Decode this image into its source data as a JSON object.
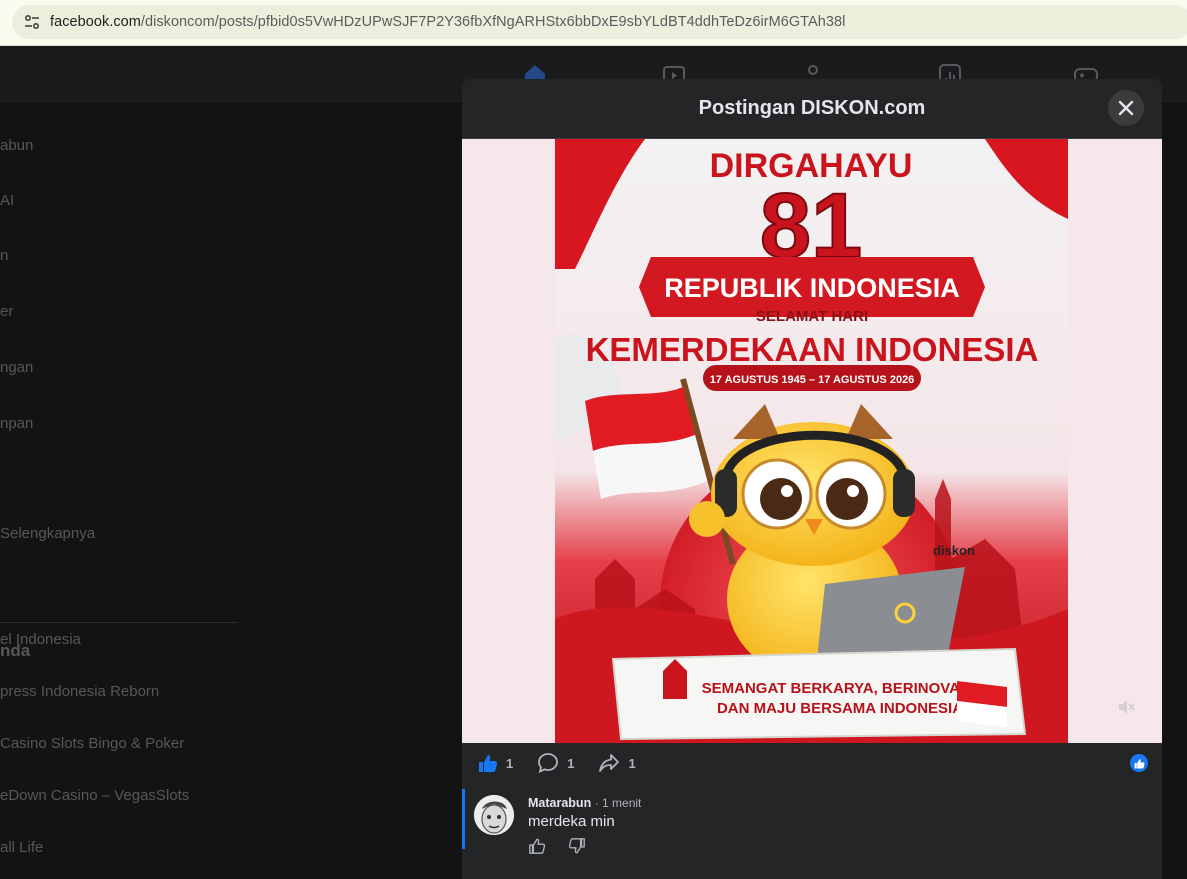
{
  "browser": {
    "url_host": "facebook.com",
    "url_path": "/diskoncom/posts/pfbid0s5VwHDzUPwSJF7P2Y36fbXfNgARHStx6bbDxE9sbYLdBT4ddhTeDz6irM6GTAh38l"
  },
  "sidebar": {
    "items": [
      "abun",
      "AI",
      "n",
      "er",
      "ngan",
      "npan",
      "Selengkapnya"
    ],
    "heading": "nda",
    "games": [
      "el Indonesia",
      "press Indonesia Reborn",
      "Casino Slots Bingo & Poker",
      "eDown Casino – VegasSlots",
      "all Life"
    ]
  },
  "modal": {
    "title": "Postingan DISKON.com",
    "poster": {
      "line1": "DIRGAHAYU",
      "number": "81",
      "banner": "REPUBLIK INDONESIA",
      "sub": "SELAMAT HARI",
      "main": "KEMERDEKAAN INDONESIA",
      "dates": "17 AGUSTUS 1945 – 17 AGUSTUS 2026",
      "brand": "diskon",
      "footer1": "SEMANGAT BERKARYA, BERINOVASI,",
      "footer2": "DAN MAJU BERSAMA INDONESIA"
    },
    "reactions": {
      "likes": "1",
      "comments": "1",
      "shares": "1"
    },
    "comment": {
      "author": "Matarabun",
      "time": "· 1 menit",
      "text": "merdeka min"
    }
  },
  "colors": {
    "accent": "#1877f2",
    "flag_red": "#d7181f"
  }
}
